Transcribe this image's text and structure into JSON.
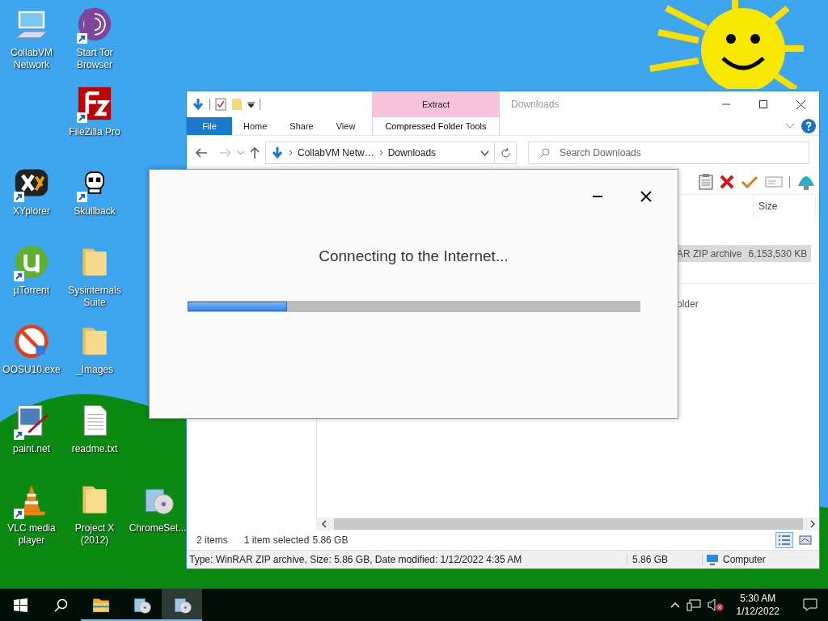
{
  "desktop_icons": [
    [
      {
        "label": "CollabVM Network",
        "kind": "monitor",
        "shortcut": false
      },
      {
        "kind": "blank"
      },
      {
        "label": "XYplorer",
        "kind": "xyplorer",
        "shortcut": true
      },
      {
        "label": "µTorrent",
        "kind": "utorrent",
        "shortcut": true
      },
      {
        "label": "OOSU10.exe",
        "kind": "oosu",
        "shortcut": false
      },
      {
        "label": "paint.net",
        "kind": "paint",
        "shortcut": true
      },
      {
        "label": "VLC media player",
        "kind": "vlc",
        "shortcut": true
      }
    ],
    [
      {
        "label": "Start Tor Browser",
        "kind": "tor",
        "shortcut": true
      },
      {
        "label": "FileZilla Pro",
        "kind": "filezilla",
        "shortcut": true
      },
      {
        "label": "Skullback",
        "kind": "skull",
        "shortcut": true
      },
      {
        "label": "Sysinternals Suite",
        "kind": "folder",
        "shortcut": false
      },
      {
        "label": "_Images",
        "kind": "folder",
        "shortcut": false
      },
      {
        "label": "readme.txt",
        "kind": "text",
        "shortcut": false
      },
      {
        "label": "Project X (2012)",
        "kind": "folder",
        "shortcut": false
      }
    ],
    [
      {
        "kind": "blank"
      },
      {
        "kind": "blank"
      },
      {
        "kind": "blank"
      },
      {
        "kind": "blank"
      },
      {
        "kind": "blank"
      },
      {
        "kind": "blank"
      },
      {
        "label": "ChromeSet...",
        "kind": "setup",
        "shortcut": false
      }
    ]
  ],
  "explorer": {
    "title": "Downloads",
    "context_tab": {
      "group": "Extract",
      "label": "Compressed Folder Tools"
    },
    "tabs": [
      {
        "label": "File",
        "kind": "file",
        "selected": false
      },
      {
        "label": "Home",
        "kind": "tab",
        "selected": false
      },
      {
        "label": "Share",
        "kind": "tab",
        "selected": false
      },
      {
        "label": "View",
        "kind": "tab",
        "selected": false
      }
    ],
    "breadcrumb": [
      "CollabVM Netw…",
      "Downloads"
    ],
    "search": {
      "placeholder": "Search Downloads"
    },
    "columns": [
      {},
      {
        "label": "Size"
      }
    ],
    "rows": [
      {
        "cells": [
          "AR ZIP archive",
          "6,153,530 KB"
        ],
        "selected": true
      },
      {
        "cells": [
          "older"
        ],
        "selected": false
      }
    ],
    "status": {
      "item_count": "2 items",
      "selection": "1 item selected",
      "selection_size": "5.86 GB",
      "views": [
        {
          "kind": "details",
          "selected": true
        },
        {
          "kind": "tiles",
          "selected": false
        }
      ]
    },
    "details_bar": {
      "info": "Type: WinRAR ZIP archive, Size: 5.86 GB, Date modified: 1/12/2022 4:35 AM",
      "size": "5.86 GB",
      "location": "Computer"
    }
  },
  "dialog": {
    "message": "Connecting to the Internet...",
    "progress": {
      "level": 0.22
    }
  },
  "taskbar": {
    "apps": [
      {
        "kind": "explorer",
        "running": true,
        "selected": false
      },
      {
        "kind": "setup",
        "running": true,
        "selected": false
      },
      {
        "kind": "setup",
        "running": true,
        "selected": true
      }
    ],
    "volume_muted": true,
    "clock": {
      "time": "5:30 AM",
      "date": "1/12/2022"
    }
  }
}
